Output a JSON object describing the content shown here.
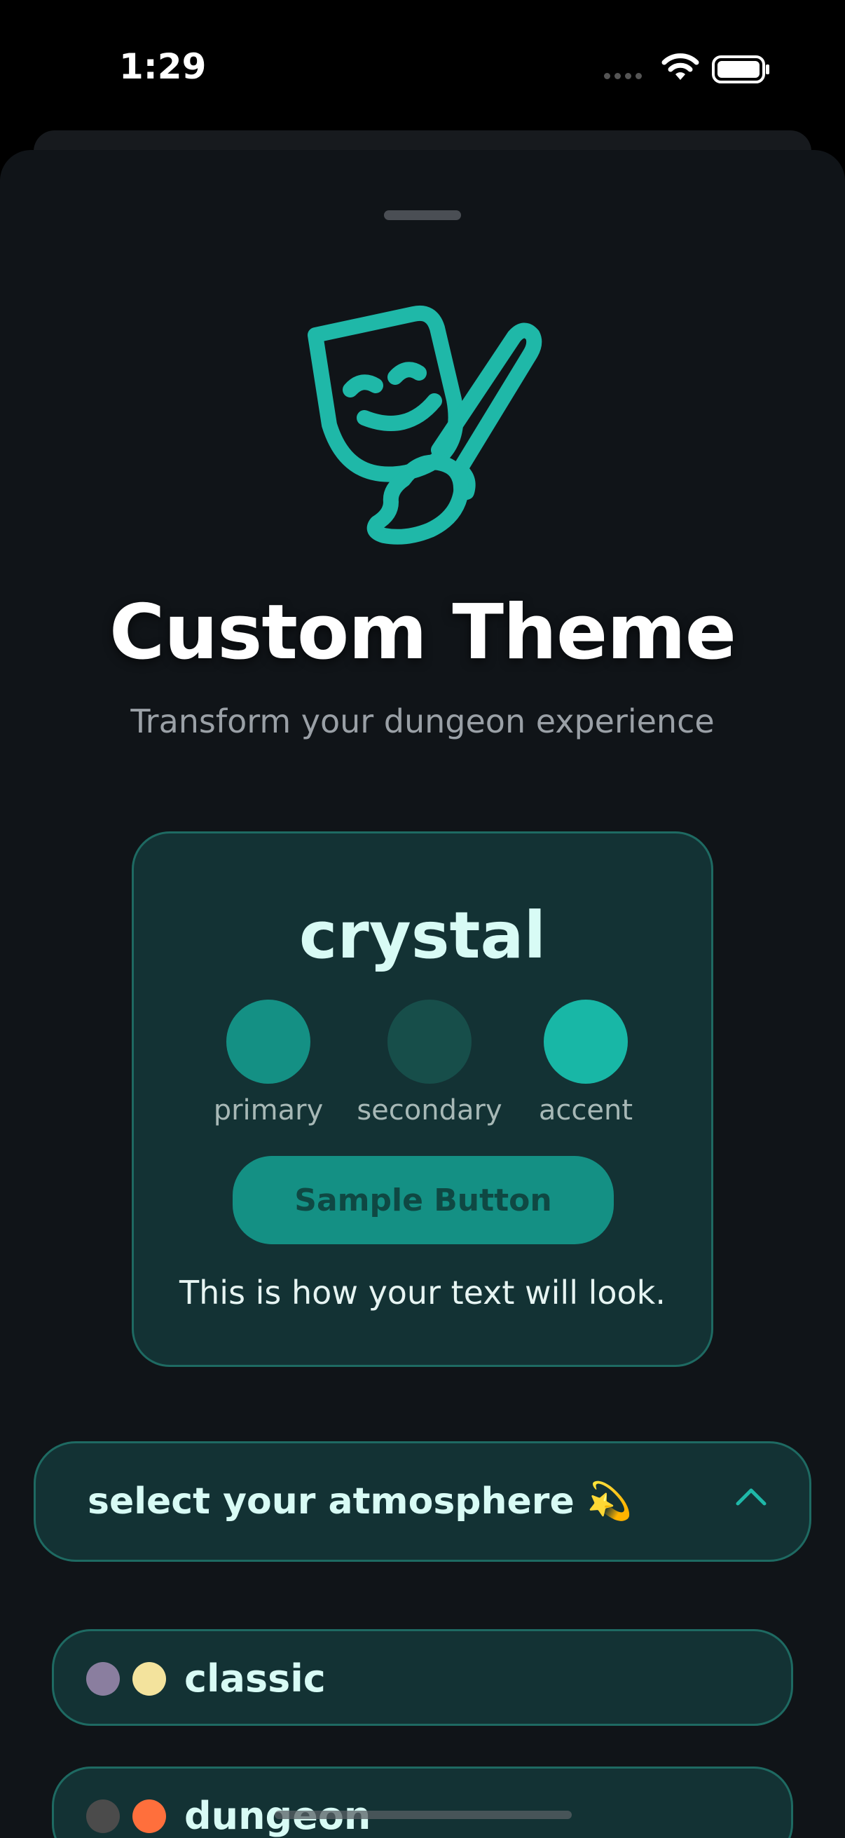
{
  "status_bar": {
    "time": "1:29"
  },
  "header": {
    "title": "Custom Theme",
    "subtitle": "Transform your dungeon experience",
    "icon": "theater-mask-brush-icon",
    "icon_color": "#1fb8a8"
  },
  "preview": {
    "theme_name": "crystal",
    "swatches": [
      {
        "label": "primary",
        "color": "#149084"
      },
      {
        "label": "secondary",
        "color": "#174e4a"
      },
      {
        "label": "accent",
        "color": "#18b7a6"
      }
    ],
    "button_label": "Sample Button",
    "sample_text": "This is how your text will look."
  },
  "atmosphere": {
    "label": "select your atmosphere 💫",
    "expanded": true,
    "options": [
      {
        "label": "classic",
        "colors": [
          "#8a7e9f",
          "#f3e39d"
        ]
      },
      {
        "label": "dungeon",
        "colors": [
          "#4b4b4b",
          "#ff6f3c"
        ]
      }
    ]
  },
  "colors": {
    "background": "#101418",
    "card": "#133234",
    "border": "#1e6a62",
    "text_light": "#d8fbf5"
  }
}
